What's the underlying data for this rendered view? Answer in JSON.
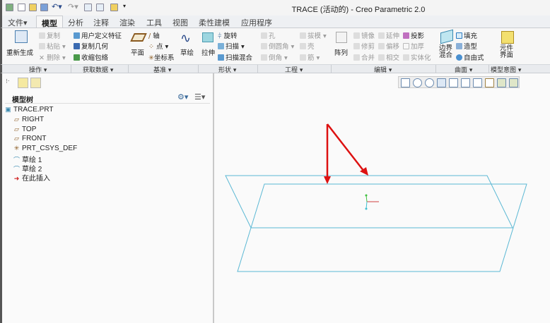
{
  "window": {
    "title": "TRACE (活动的) - Creo Parametric 2.0"
  },
  "quick_access": [
    "new-icon",
    "open-icon",
    "save-icon",
    "undo-icon",
    "redo-icon",
    "regenerate-icon",
    "windows-icon",
    "close-icon",
    "customize-icon"
  ],
  "tabs": [
    {
      "label": "文件",
      "active": false
    },
    {
      "label": "模型",
      "active": true
    },
    {
      "label": "分析"
    },
    {
      "label": "注释"
    },
    {
      "label": "渲染"
    },
    {
      "label": "工具"
    },
    {
      "label": "视图"
    },
    {
      "label": "柔性建模"
    },
    {
      "label": "应用程序"
    }
  ],
  "ribbon": {
    "operations": {
      "label": "操作",
      "regenerate": "重新生成",
      "copy": "复制",
      "paste": "粘贴",
      "delete": "删除"
    },
    "get_data": {
      "label": "获取数据",
      "udf": "用户定义特征",
      "copy_geom": "复制几何",
      "shrinkwrap": "收缩包络"
    },
    "datum": {
      "label": "基准",
      "plane": "平面",
      "axis": "轴",
      "point": "点",
      "csys": "坐标系",
      "sketch": "草绘"
    },
    "shapes": {
      "label": "形状",
      "extrude": "拉伸",
      "revolve": "旋转",
      "sweep": "扫描",
      "swept_blend": "扫描混合"
    },
    "engineering": {
      "label": "工程",
      "hole": "孔",
      "round": "倒圆角",
      "chamfer": "倒角",
      "draft": "拔模",
      "shell": "壳",
      "rib": "筋"
    },
    "editing": {
      "label": "编辑",
      "pattern": "阵列",
      "mirror": "镜像",
      "trim": "修剪",
      "merge": "合并",
      "extend": "延伸",
      "offset": "偏移",
      "intersect": "相交",
      "project": "投影",
      "thicken": "加厚",
      "solidify": "实体化"
    },
    "surfaces": {
      "label": "曲面",
      "boundary_blend": "边界混合",
      "fill": "填充",
      "style": "造型",
      "freestyle": "自由式"
    },
    "model_intent": {
      "label": "模型意图",
      "component_interface": "元件界面"
    }
  },
  "model_tree": {
    "title": "模型树",
    "items": [
      {
        "label": "TRACE.PRT",
        "icon": "part-icon"
      },
      {
        "label": "RIGHT",
        "icon": "datum-plane-icon"
      },
      {
        "label": "TOP",
        "icon": "datum-plane-icon"
      },
      {
        "label": "FRONT",
        "icon": "datum-plane-icon"
      },
      {
        "label": "PRT_CSYS_DEF",
        "icon": "csys-icon"
      },
      {
        "label": "草绘 1",
        "icon": "sketch-icon"
      },
      {
        "label": "草绘 2",
        "icon": "sketch-icon"
      },
      {
        "label": "在此插入",
        "icon": "insert-here-arrow-icon"
      }
    ]
  },
  "view_toolbar": [
    "refit-icon",
    "zoom-in-icon",
    "zoom-out-icon",
    "repaint-icon",
    "display-style-icon",
    "saved-orientations-icon",
    "view-manager-icon",
    "datum-display-icon",
    "spin-center-icon",
    "annotation-display-icon"
  ],
  "colors": {
    "datum_plane": "#5bb8d4",
    "trajectory_arrow": "#dd1111",
    "tab_active_bg": "#f7f7f7"
  }
}
